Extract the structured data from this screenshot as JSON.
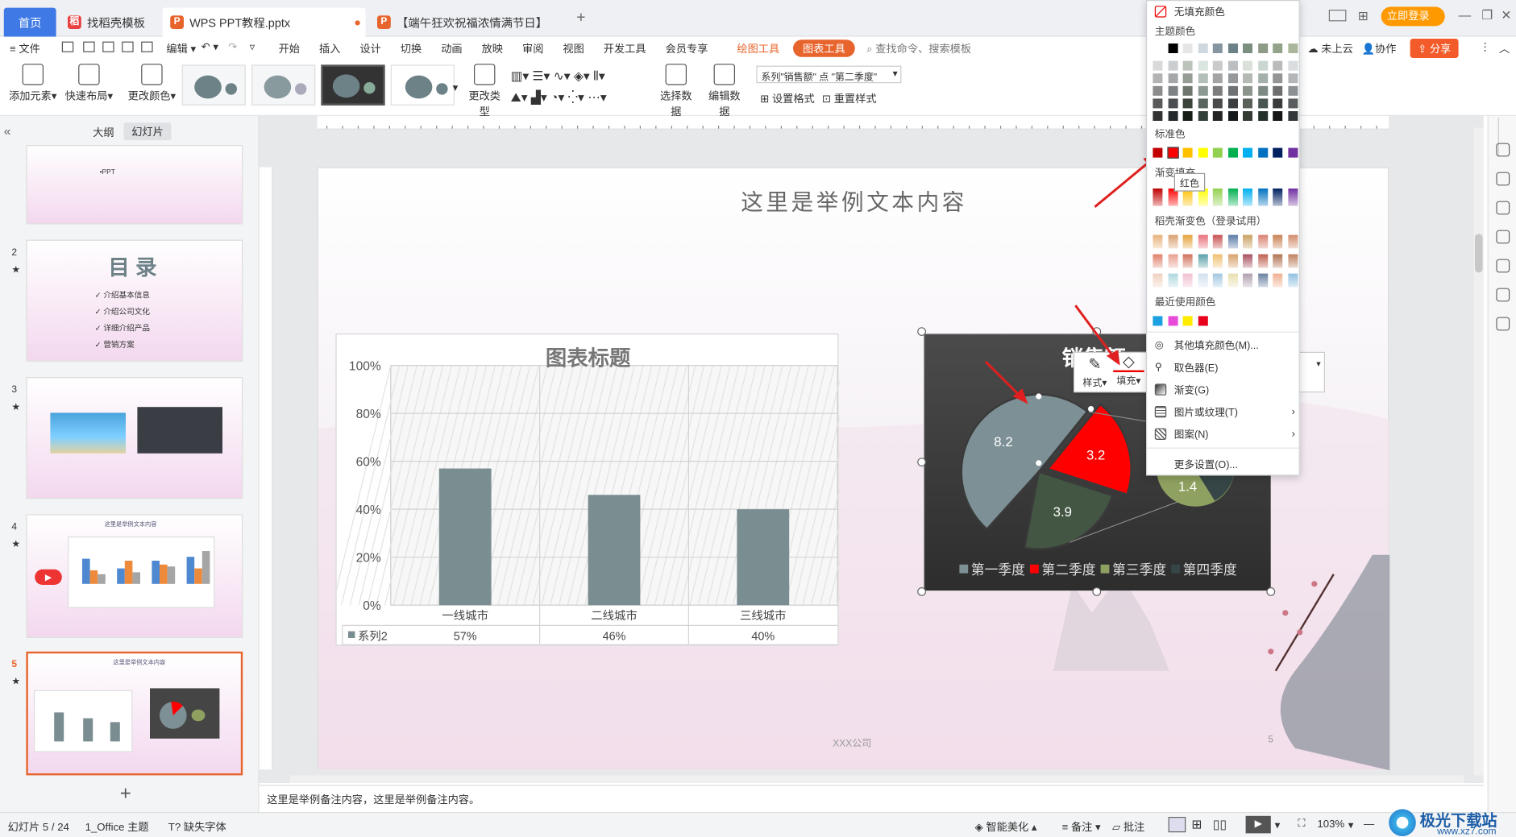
{
  "tabs": {
    "home": "首页",
    "template": "找稻壳模板",
    "doc": "WPS PPT教程.pptx",
    "doc2": "【端午狂欢祝福浓情满节日】",
    "add": "+"
  },
  "titlebar": {
    "login": "立即登录",
    "minimize": "—",
    "restore": "❐",
    "close": "✕"
  },
  "menu": {
    "file": "文件",
    "edit": "编辑",
    "items": [
      "开始",
      "插入",
      "设计",
      "切换",
      "动画",
      "放映",
      "审阅",
      "视图",
      "开发工具",
      "会员专享"
    ],
    "draw_tools": "绘图工具",
    "chart_tools": "图表工具",
    "search": "查找命令、搜索模板",
    "cloud": "未上云",
    "collab": "协作",
    "share": "分享"
  },
  "toolbar": {
    "add_element": "添加元素",
    "quick_layout": "快速布局",
    "change_color": "更改颜色",
    "change_type": "更改类型",
    "select_data": "选择数据",
    "edit_data": "编辑数据",
    "series_select": "系列\"销售额\" 点 \"第二季度\"",
    "set_format": "设置格式",
    "reset_style": "重置样式"
  },
  "leftpanel": {
    "outline": "大纲",
    "slides": "幻灯片",
    "slide1_text": "•PPT",
    "slide2_title": "目 录",
    "slide2_items": [
      "介绍基本信息",
      "介绍公司文化",
      "详细介绍产品",
      "营销方案"
    ],
    "slide4_title": "这里是举例文本内容",
    "slide5_title": "这里是举例文本内容",
    "nums": [
      "2",
      "3",
      "4",
      "5"
    ],
    "add": "+"
  },
  "slide": {
    "title": "这里是举例文本内容",
    "footer_company": "XXX公司",
    "footer_page": "5"
  },
  "chart_data": [
    {
      "type": "bar",
      "title": "图表标题",
      "categories": [
        "一线城市",
        "二线城市",
        "三线城市"
      ],
      "series": [
        {
          "name": "系列2",
          "values": [
            57,
            46,
            40
          ]
        }
      ],
      "value_labels": [
        "57%",
        "46%",
        "40%"
      ],
      "yticks": [
        "100%",
        "80%",
        "60%",
        "40%",
        "20%",
        "0%"
      ],
      "ylim": [
        0,
        100
      ],
      "grid": true,
      "legend": "bottom-left data table",
      "bar_color": "#7a8d91"
    },
    {
      "type": "pie",
      "title": "销售额",
      "categories": [
        "第一季度",
        "第二季度",
        "第三季度",
        "第四季度"
      ],
      "values": [
        8.2,
        3.2,
        3.9,
        1.4
      ],
      "labels": [
        "8.2",
        "3.2",
        "3.9",
        "1.4"
      ],
      "colors": [
        "#7d9095",
        "#ff0000",
        "#435643",
        "#8fa160"
      ],
      "legend": "bottom"
    }
  ],
  "float_toolbar": {
    "style": "样式",
    "fill": "填充"
  },
  "colorpanel": {
    "no_fill": "无填充颜色",
    "theme_colors": "主题颜色",
    "standard_colors": "标准色",
    "gradient": "渐变填充",
    "tooltip": "红色",
    "docer_gradient": "稻壳渐变色（登录试用）",
    "recent": "最近使用颜色",
    "more_fill": "其他填充颜色(M)...",
    "eyedropper": "取色器(E)",
    "gradient_item": "渐变(G)",
    "picture": "图片或纹理(T)",
    "pattern": "图案(N)",
    "more_settings": "更多设置(O)...",
    "standard": [
      "#c00000",
      "#ff0000",
      "#ffc000",
      "#ffff00",
      "#92d050",
      "#00b050",
      "#00b0f0",
      "#0070c0",
      "#002060",
      "#7030a0"
    ],
    "recent_colors": [
      "#1ba1e2",
      "#e84bd8",
      "#ffeb00",
      "#e8001c"
    ]
  },
  "notes": "这里是举例备注内容，这里是举例备注内容。",
  "status": {
    "slide_count": "幻灯片 5 / 24",
    "theme": "1_Office 主题",
    "missing_font": "缺失字体",
    "beautify": "智能美化",
    "notes_btn": "备注",
    "comment_btn": "批注",
    "zoom": "103%",
    "watermark": "极光下载站",
    "watermark_url": "www.xz7.com"
  }
}
